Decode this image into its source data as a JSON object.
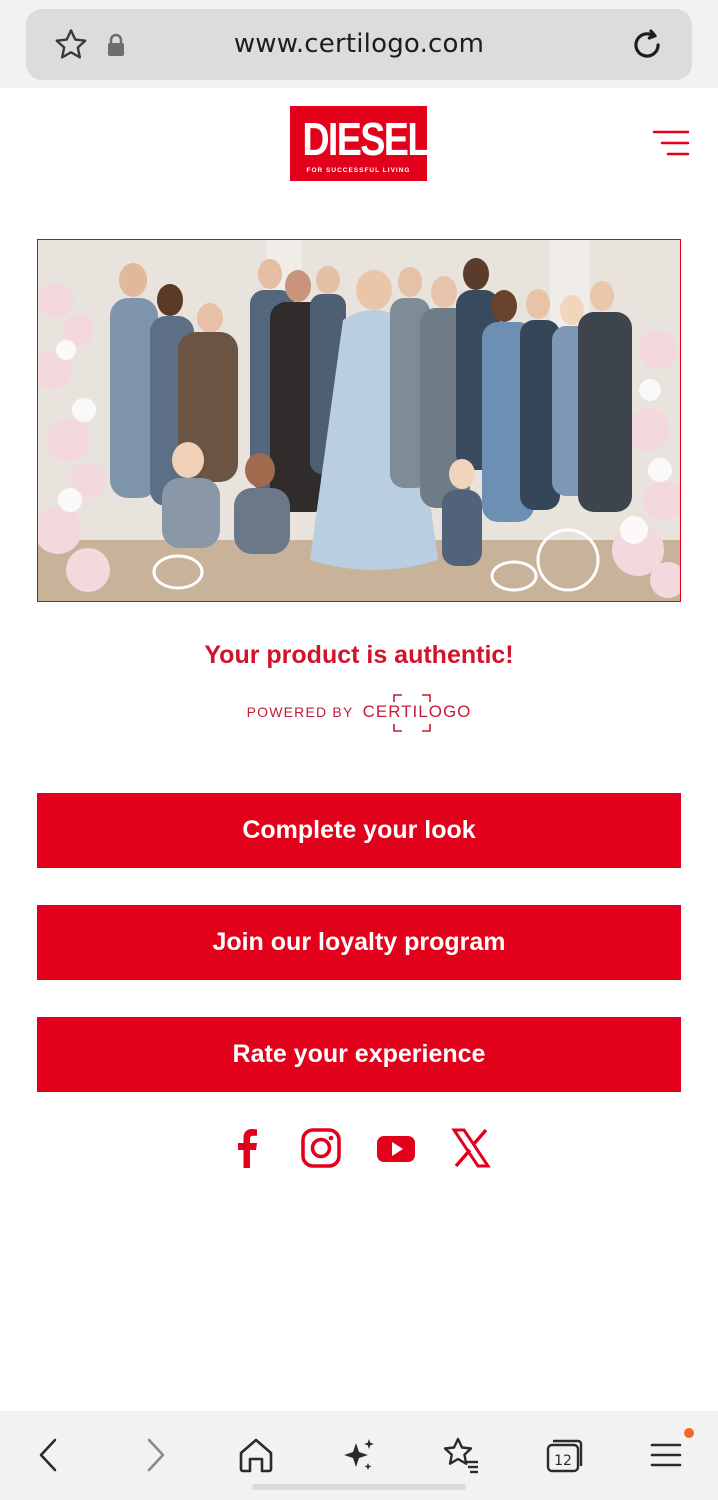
{
  "browser": {
    "url": "www.certilogo.com",
    "tab_count": "12",
    "menu_badge_color": "#f26a21"
  },
  "header": {
    "brand": "DIESEL",
    "brand_mark": "®",
    "tagline": "FOR SUCCESSFUL LIVING",
    "menu_icon": "hamburger-menu-icon"
  },
  "hero": {
    "image": "campaign-group-photo"
  },
  "verification": {
    "headline": "Your product is authentic!",
    "powered_label": "POWERED BY",
    "powered_brand": "CERTILOGO"
  },
  "actions": {
    "complete_look": "Complete your look",
    "loyalty": "Join our loyalty program",
    "rate": "Rate your experience"
  },
  "social": [
    "facebook-icon",
    "instagram-icon",
    "youtube-icon",
    "x-icon"
  ],
  "colors": {
    "brand_red": "#e2001a",
    "headline_red": "#d3132b"
  },
  "bottom_nav": [
    "back-icon",
    "forward-icon",
    "home-icon",
    "ai-sparkle-icon",
    "bookmarks-icon",
    "tabs-icon",
    "menu-icon"
  ]
}
